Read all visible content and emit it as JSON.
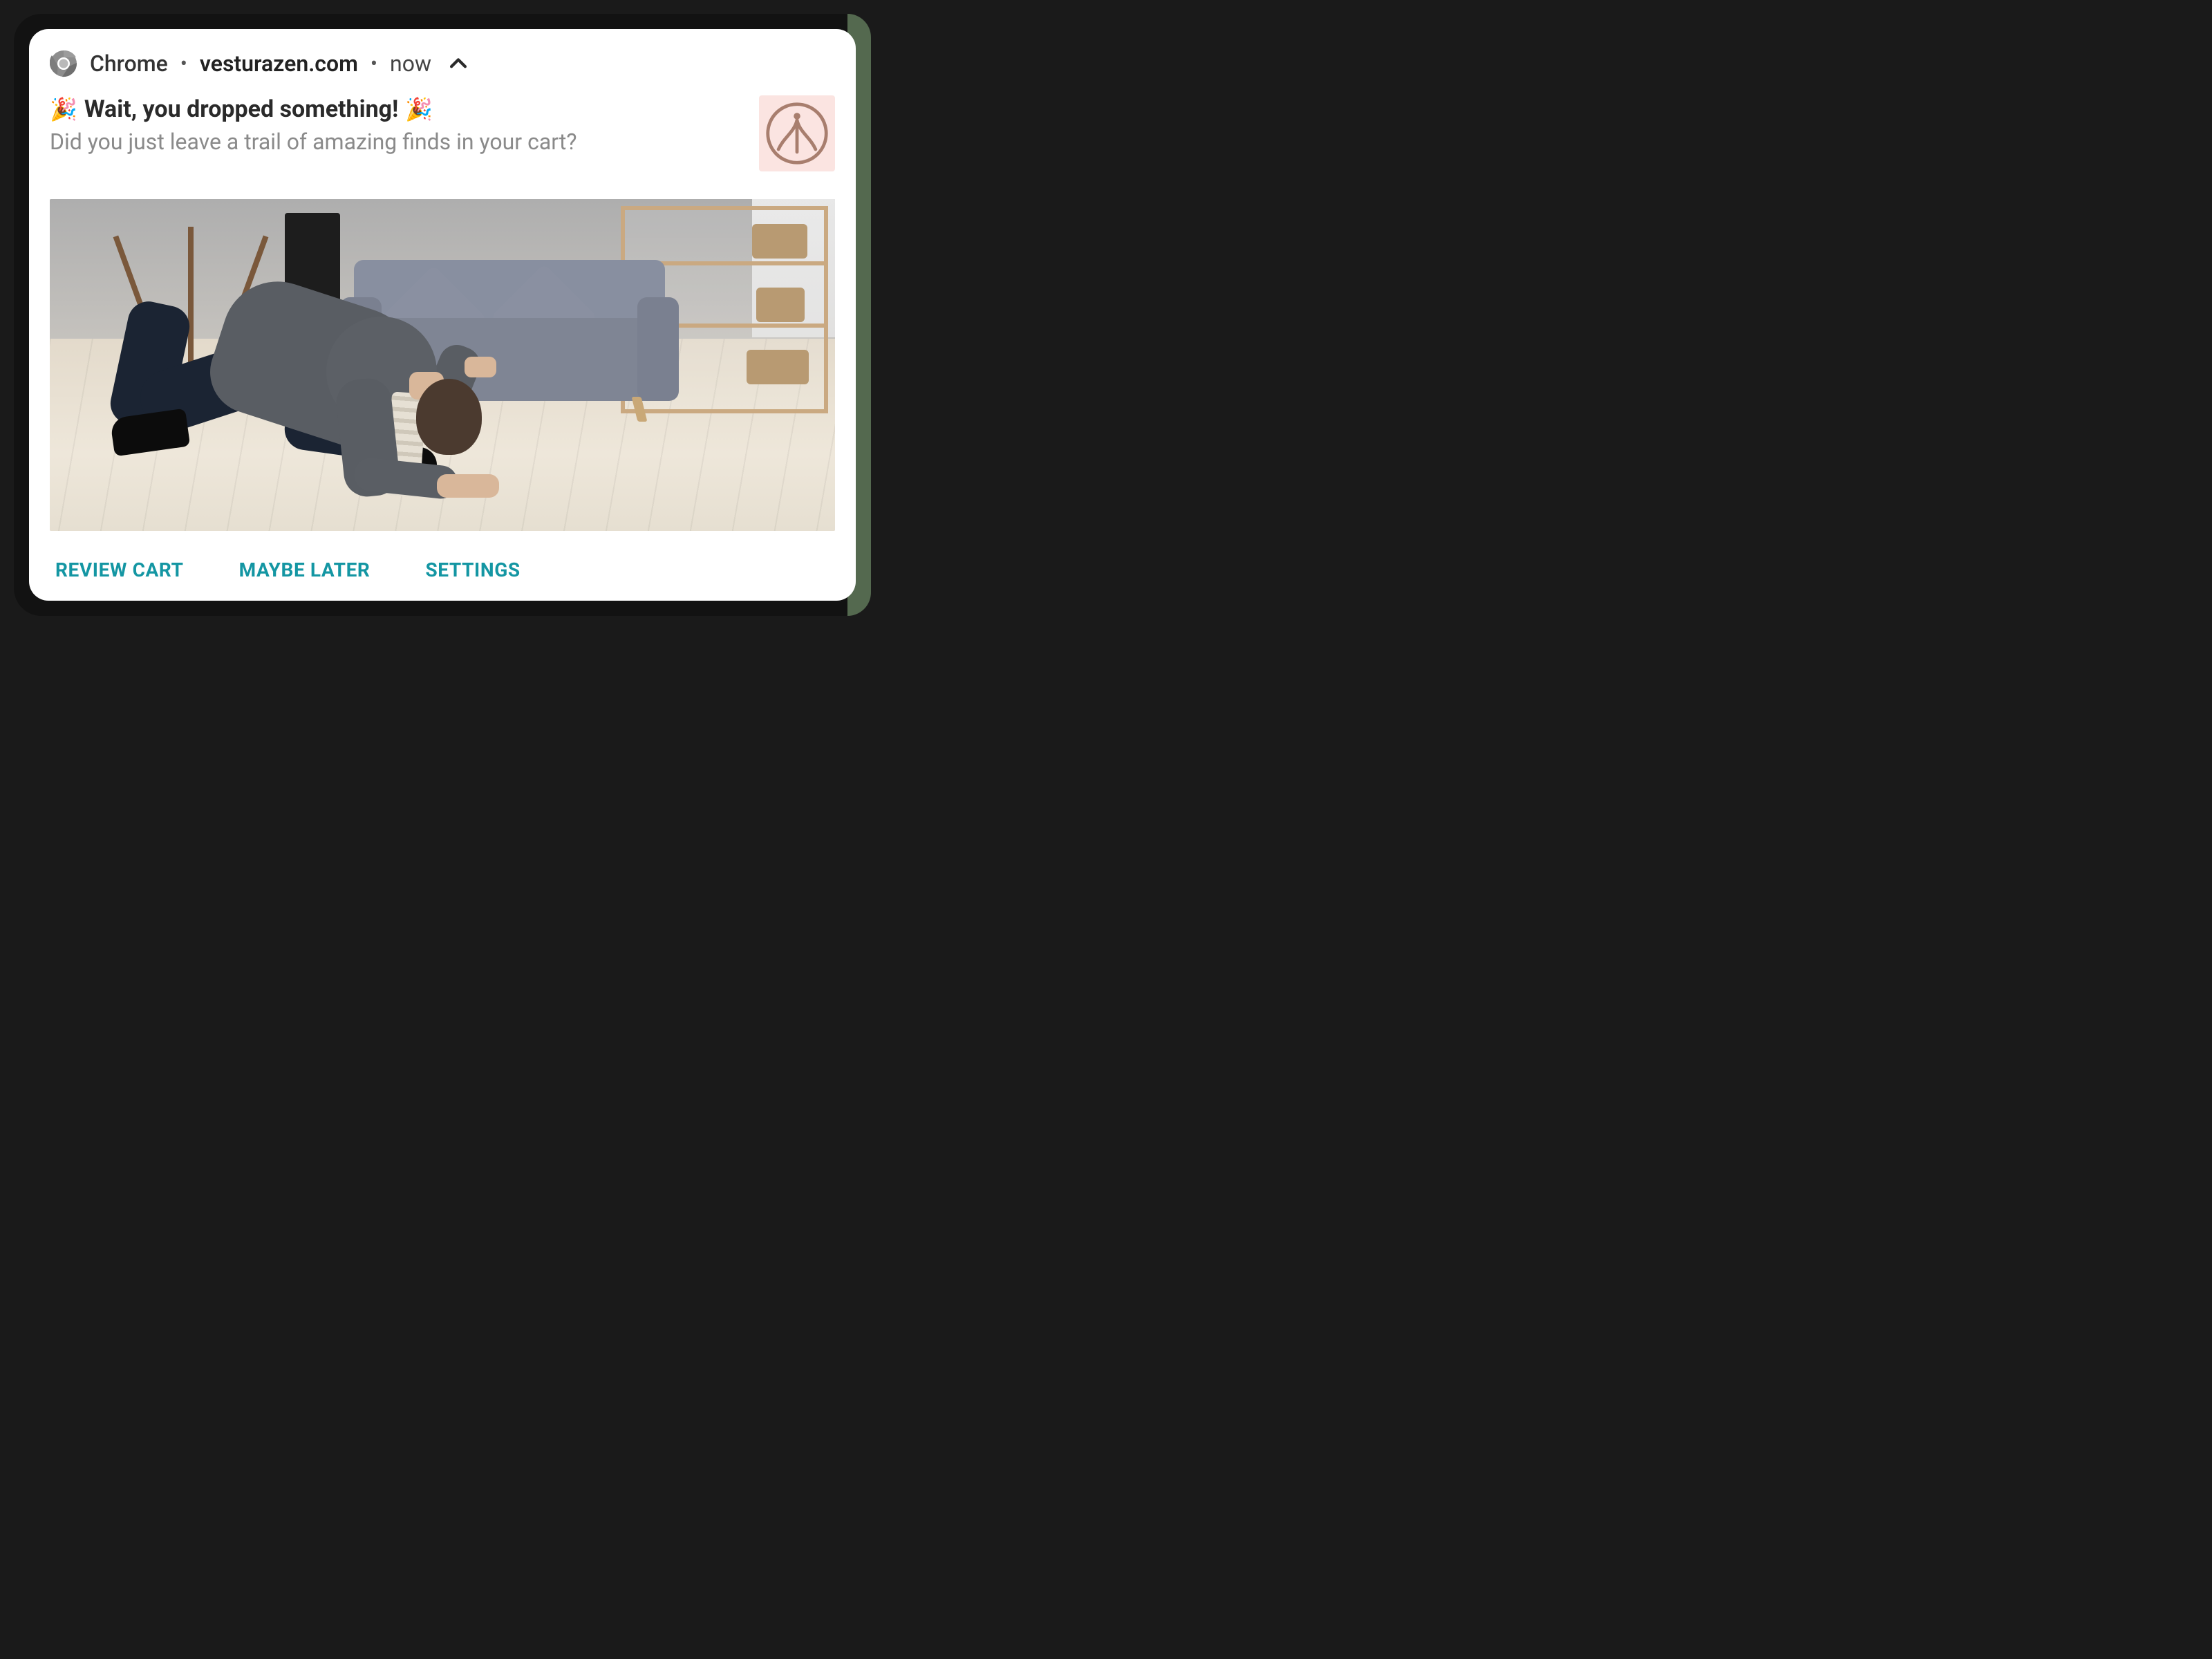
{
  "header": {
    "app": "Chrome",
    "domain": "vesturazen.com",
    "time": "now"
  },
  "notification": {
    "title": "Wait, you dropped something!",
    "emoji": "🎉",
    "body": "Did you just leave a trail of amazing finds in your cart?"
  },
  "hero": {
    "description": "Man kneeling on a light wood floor looking under a grey sofa in a living room with shelves and baskets"
  },
  "brand": {
    "name": "vesturazen-logo"
  },
  "actions": {
    "review": "REVIEW CART",
    "later": "MAYBE LATER",
    "settings": "SETTINGS"
  },
  "colors": {
    "action": "#1496a3"
  }
}
